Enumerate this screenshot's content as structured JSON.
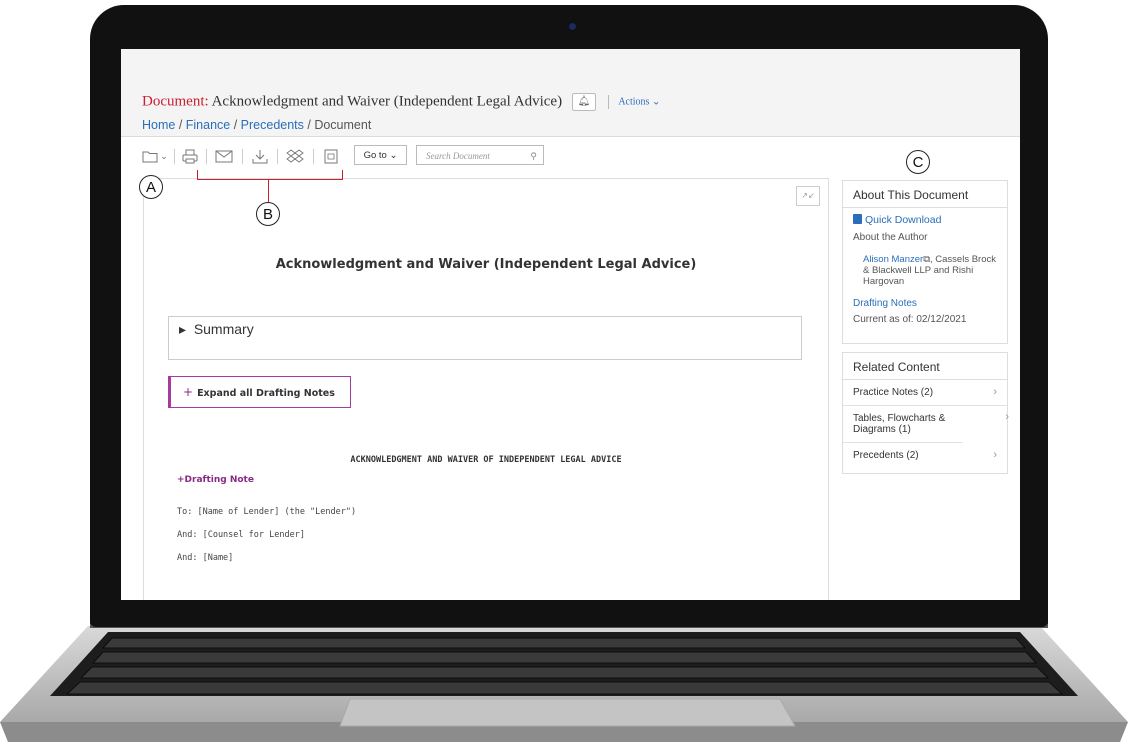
{
  "header": {
    "title_prefix": "Document:",
    "title": "Acknowledgment and Waiver (Independent Legal Advice)",
    "bell_icon": "bell-icon",
    "actions_label": "Actions",
    "breadcrumb": {
      "home": "Home",
      "sep1": " / ",
      "finance": "Finance",
      "sep2": " / ",
      "precedents": "Precedents",
      "sep3": " / ",
      "current": "Document"
    }
  },
  "toolbar": {
    "icons": [
      "folder-icon",
      "print-icon",
      "email-icon",
      "download-icon",
      "dropbox-icon",
      "document-icon"
    ],
    "goto_label": "Go to",
    "search_placeholder": "Search Document"
  },
  "document": {
    "heading": "Acknowledgment and Waiver (Independent Legal Advice)",
    "summary_label": "Summary",
    "expand_label": "Expand all Drafting Notes",
    "ack_heading": "ACKNOWLEDGMENT AND WAIVER OF INDEPENDENT LEGAL ADVICE",
    "drafting_note": "Drafting Note",
    "lines": [
      "To: [Name of Lender] (the \"Lender\")",
      "And: [Counsel for Lender]",
      "And: [Name]"
    ]
  },
  "about": {
    "title": "About This Document",
    "quick_download": "Quick Download",
    "about_author": "About the Author",
    "author_name": "Alison Manzer",
    "author_rest": ", Cassels Brock & Blackwell LLP and Rishi Hargovan",
    "drafting_notes": "Drafting Notes",
    "current_as_of": "Current as of: 02/12/2021"
  },
  "related": {
    "title": "Related Content",
    "items": [
      {
        "label": "Practice Notes (2)"
      },
      {
        "label": "Tables, Flowcharts & Diagrams (1)"
      },
      {
        "label": "Precedents (2)"
      }
    ]
  },
  "callouts": {
    "a": "A",
    "b": "B",
    "c": "C"
  },
  "colors": {
    "accent_red": "#c8202f",
    "link_blue": "#2a6ebb",
    "purple": "#8a2a86"
  }
}
